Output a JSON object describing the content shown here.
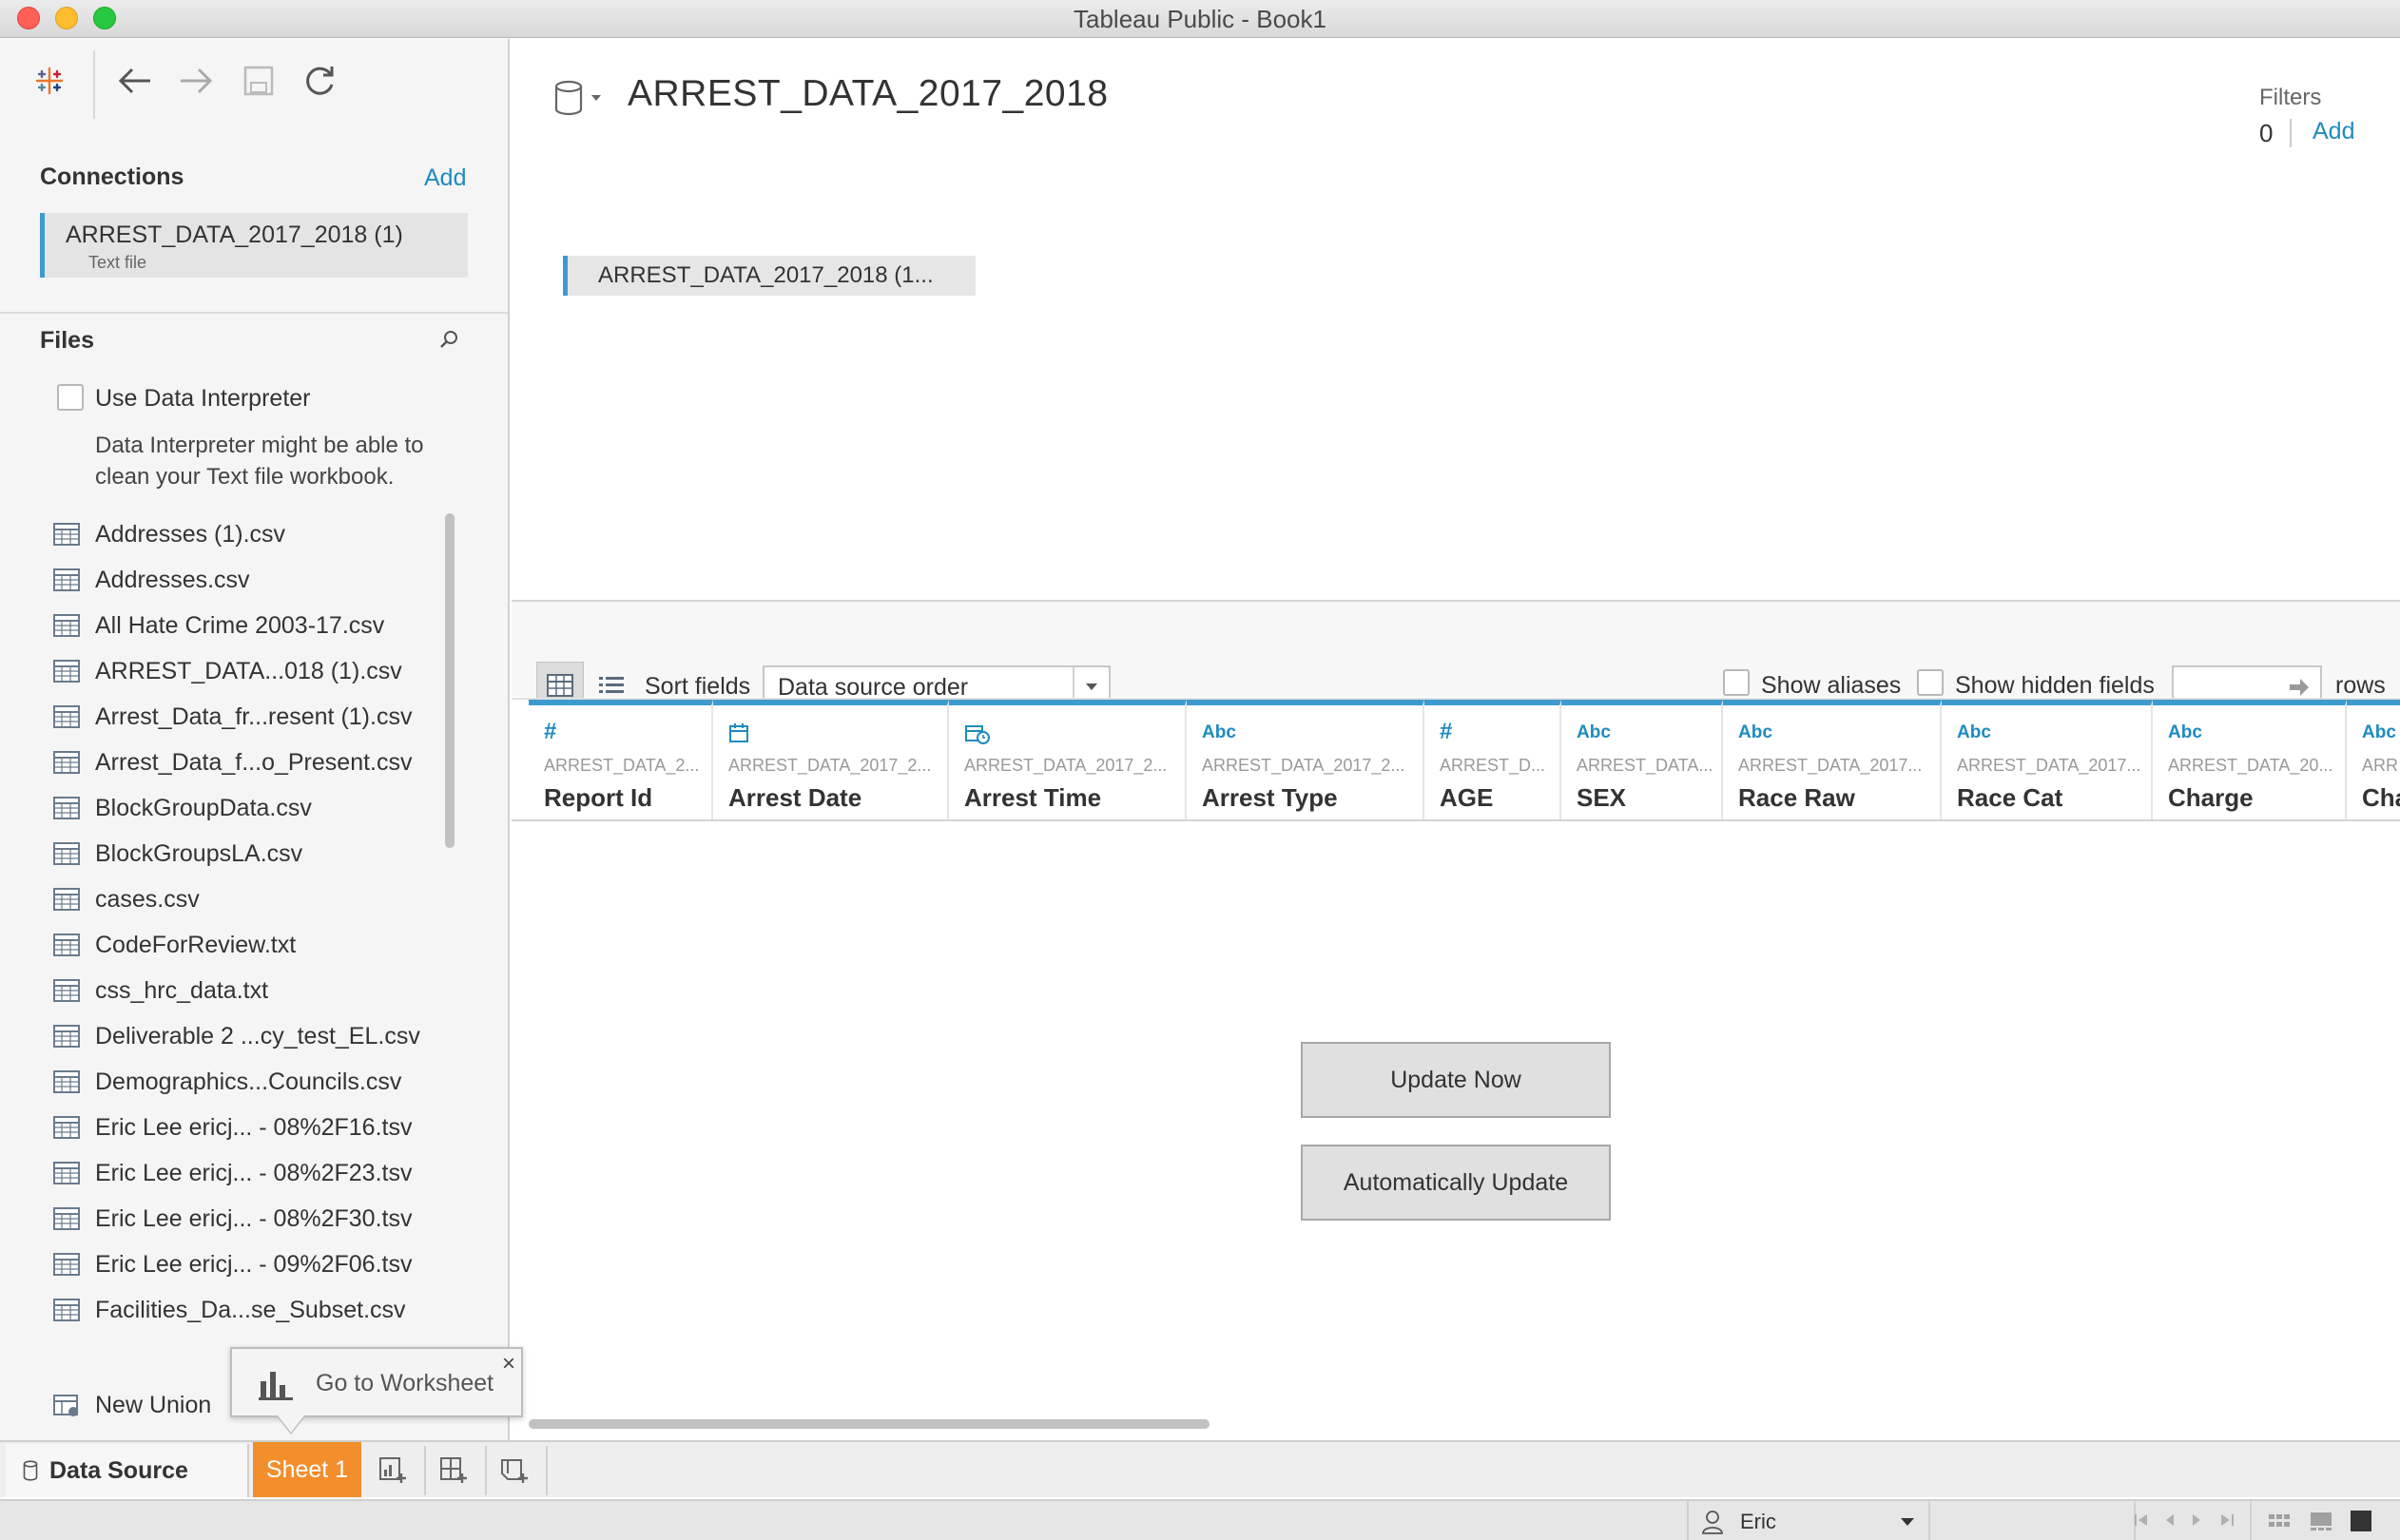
{
  "window": {
    "title": "Tableau Public - Book1"
  },
  "connections": {
    "title": "Connections",
    "add_label": "Add",
    "item": {
      "name": "ARREST_DATA_2017_2018 (1)",
      "type": "Text file"
    }
  },
  "files": {
    "title": "Files",
    "interpreter_label": "Use Data Interpreter",
    "interpreter_desc": "Data Interpreter might be able to clean your Text file workbook.",
    "items": [
      "Addresses (1).csv",
      "Addresses.csv",
      "All Hate Crime 2003-17.csv",
      "ARREST_DATA...018 (1).csv",
      "Arrest_Data_fr...resent (1).csv",
      "Arrest_Data_f...o_Present.csv",
      "BlockGroupData.csv",
      "BlockGroupsLA.csv",
      "cases.csv",
      "CodeForReview.txt",
      "css_hrc_data.txt",
      "Deliverable 2 ...cy_test_EL.csv",
      "Demographics...Councils.csv",
      "Eric Lee ericj... - 08%2F16.tsv",
      "Eric Lee ericj... - 08%2F23.tsv",
      "Eric Lee ericj... - 08%2F30.tsv",
      "Eric Lee ericj... - 09%2F06.tsv",
      "Facilities_Da...se_Subset.csv"
    ],
    "new_union": "New Union"
  },
  "datasource": {
    "title": "ARREST_DATA_2017_2018",
    "table_pill": "ARREST_DATA_2017_2018 (1..."
  },
  "filters": {
    "label": "Filters",
    "count": "0",
    "add_label": "Add"
  },
  "grid_toolbar": {
    "sort_label": "Sort fields",
    "sort_value": "Data source order",
    "show_aliases": "Show aliases",
    "show_hidden": "Show hidden fields",
    "rows_label": "rows"
  },
  "columns": [
    {
      "type": "#",
      "source": "ARREST_DATA_2...",
      "name": "Report Id"
    },
    {
      "type": "date",
      "source": "ARREST_DATA_2017_2...",
      "name": "Arrest Date"
    },
    {
      "type": "datetime",
      "source": "ARREST_DATA_2017_2...",
      "name": "Arrest Time"
    },
    {
      "type": "Abc",
      "source": "ARREST_DATA_2017_2...",
      "name": "Arrest Type"
    },
    {
      "type": "#",
      "source": "ARREST_D...",
      "name": "AGE"
    },
    {
      "type": "Abc",
      "source": "ARREST_DATA...",
      "name": "SEX"
    },
    {
      "type": "Abc",
      "source": "ARREST_DATA_2017...",
      "name": "Race Raw"
    },
    {
      "type": "Abc",
      "source": "ARREST_DATA_2017...",
      "name": "Race Cat"
    },
    {
      "type": "Abc",
      "source": "ARREST_DATA_20...",
      "name": "Charge"
    },
    {
      "type": "Abc",
      "source": "ARR",
      "name": "Cha"
    }
  ],
  "actions": {
    "update_now": "Update Now",
    "auto_update": "Automatically Update"
  },
  "popup": {
    "label": "Go to Worksheet",
    "close": "×"
  },
  "tabs": {
    "data_source": "Data Source",
    "sheet1": "Sheet 1"
  },
  "status": {
    "user": "Eric"
  },
  "colors": {
    "accent": "#3d9ad1",
    "link": "#1f8bbf",
    "sheet_tab": "#f28e2b"
  }
}
